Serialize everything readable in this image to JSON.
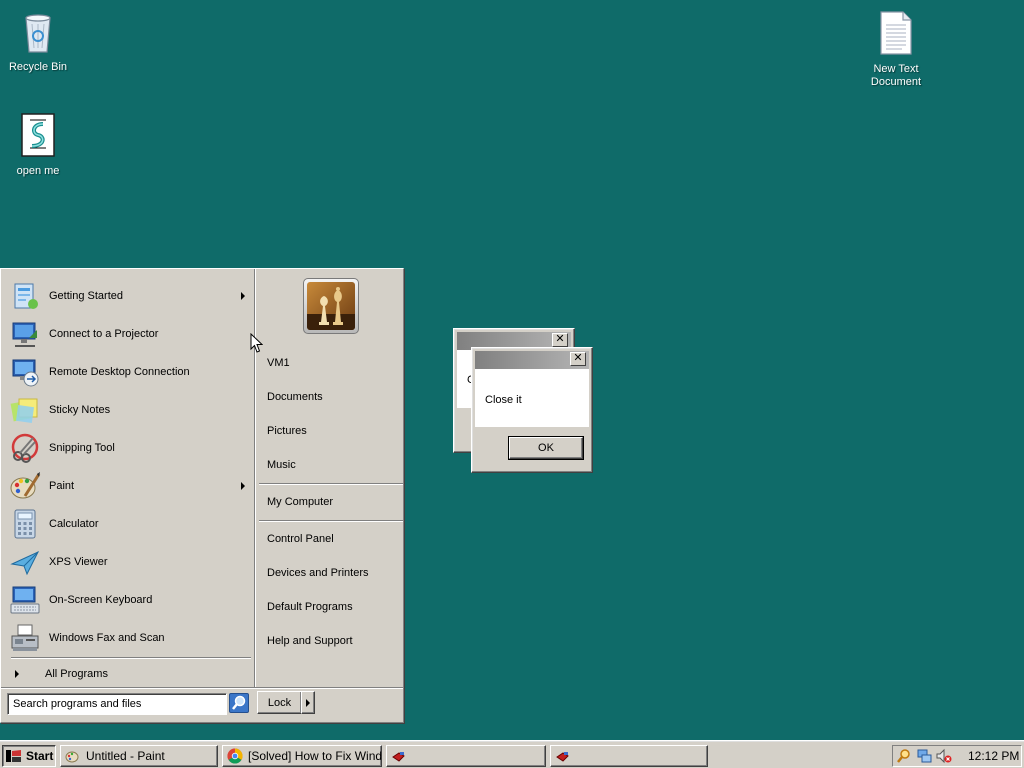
{
  "desktop": {
    "background_color": "#0f6b69",
    "icons": [
      {
        "label": "Recycle Bin",
        "icon": "recycle-bin-icon"
      },
      {
        "label": "open me",
        "icon": "script-file-icon"
      },
      {
        "label": "New Text Document",
        "icon": "text-document-icon"
      }
    ]
  },
  "start_menu": {
    "programs": [
      {
        "label": "Getting Started",
        "icon": "getting-started-icon",
        "has_submenu": true
      },
      {
        "label": "Connect to a Projector",
        "icon": "projector-icon",
        "has_submenu": false
      },
      {
        "label": "Remote Desktop Connection",
        "icon": "remote-desktop-icon",
        "has_submenu": false
      },
      {
        "label": "Sticky Notes",
        "icon": "sticky-notes-icon",
        "has_submenu": false
      },
      {
        "label": "Snipping Tool",
        "icon": "scissors-icon",
        "has_submenu": false
      },
      {
        "label": "Paint",
        "icon": "paint-palette-icon",
        "has_submenu": true
      },
      {
        "label": "Calculator",
        "icon": "calculator-icon",
        "has_submenu": false
      },
      {
        "label": "XPS Viewer",
        "icon": "xps-viewer-icon",
        "has_submenu": false
      },
      {
        "label": "On-Screen Keyboard",
        "icon": "keyboard-icon",
        "has_submenu": false
      },
      {
        "label": "Windows Fax and Scan",
        "icon": "fax-icon",
        "has_submenu": false
      }
    ],
    "all_programs": "All Programs",
    "user_picture": "chess-pieces-avatar",
    "right_links": [
      {
        "label": "VM1"
      },
      {
        "label": "Documents"
      },
      {
        "label": "Pictures"
      },
      {
        "label": "Music"
      },
      {
        "label": "My Computer"
      },
      {
        "label": "Control Panel"
      },
      {
        "label": "Devices and Printers"
      },
      {
        "label": "Default Programs"
      },
      {
        "label": "Help and Support"
      }
    ],
    "search_placeholder": "Search programs and files",
    "lock_label": "Lock"
  },
  "dialogs": {
    "back": {
      "partial_text": "C"
    },
    "front": {
      "message": "Close it",
      "ok_label": "OK",
      "close_glyph": "✕"
    }
  },
  "taskbar": {
    "start_label": "Start",
    "tasks": [
      {
        "label": "Untitled - Paint",
        "icon": "paint-icon"
      },
      {
        "label": "[Solved] How to Fix Windo...",
        "icon": "chrome-icon"
      },
      {
        "label": "",
        "icon": "app-icon"
      },
      {
        "label": "",
        "icon": "app-icon"
      }
    ],
    "tray_icons": [
      "search-tray-icon",
      "network-icon",
      "volume-muted-icon"
    ],
    "clock": "12:12 PM"
  }
}
